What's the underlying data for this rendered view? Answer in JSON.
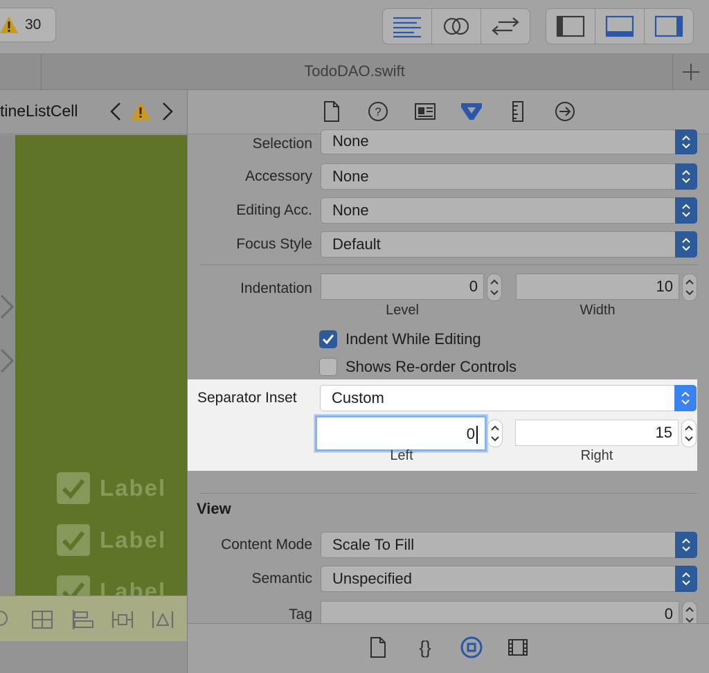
{
  "toolbar": {
    "warning_count": "30",
    "editor_buttons": [
      {
        "icon": "standard-editor-icon"
      },
      {
        "icon": "assistant-editor-icon"
      },
      {
        "icon": "version-editor-icon"
      }
    ],
    "view_buttons": [
      {
        "icon": "navigator-toggle-icon"
      },
      {
        "icon": "debug-area-toggle-icon"
      },
      {
        "icon": "utilities-toggle-icon"
      }
    ]
  },
  "tabbar": {
    "title": "TodoDAO.swift",
    "add_tab_icon": "plus-icon"
  },
  "jumpbar": {
    "crumb": "tineListCell"
  },
  "canvas": {
    "cells": [
      {
        "label": "Label"
      },
      {
        "label": "Label"
      },
      {
        "label": "Label"
      }
    ],
    "accent": "#5f7427"
  },
  "inspector": {
    "tabs": [
      "file-icon",
      "help-icon",
      "identity-icon",
      "attributes-icon",
      "size-icon",
      "connections-icon"
    ],
    "rows": {
      "selection": {
        "label": "Selection",
        "value": "None"
      },
      "accessory": {
        "label": "Accessory",
        "value": "None"
      },
      "editing_acc": {
        "label": "Editing Acc.",
        "value": "None"
      },
      "focus_style": {
        "label": "Focus Style",
        "value": "Default"
      },
      "indentation": {
        "label": "Indentation",
        "level": "0",
        "level_label": "Level",
        "width": "10",
        "width_label": "Width"
      },
      "indent_while_editing": {
        "label": "Indent While Editing",
        "checked": true
      },
      "shows_reorder": {
        "label": "Shows Re-order Controls",
        "checked": false
      },
      "separator_inset": {
        "label": "Separator Inset",
        "value": "Custom",
        "left": "0",
        "left_label": "Left",
        "right": "15",
        "right_label": "Right"
      }
    },
    "view_section": {
      "title": "View",
      "content_mode": {
        "label": "Content Mode",
        "value": "Scale To Fill"
      },
      "semantic": {
        "label": "Semantic",
        "value": "Unspecified"
      },
      "tag": {
        "label": "Tag",
        "value": "0"
      }
    },
    "library_tabs": [
      "file-template-icon",
      "code-snippet-icon",
      "object-library-icon",
      "media-library-icon"
    ]
  },
  "colors": {
    "accent_blue": "#3b82f1",
    "selected_tab_blue": "#2d5a99"
  }
}
